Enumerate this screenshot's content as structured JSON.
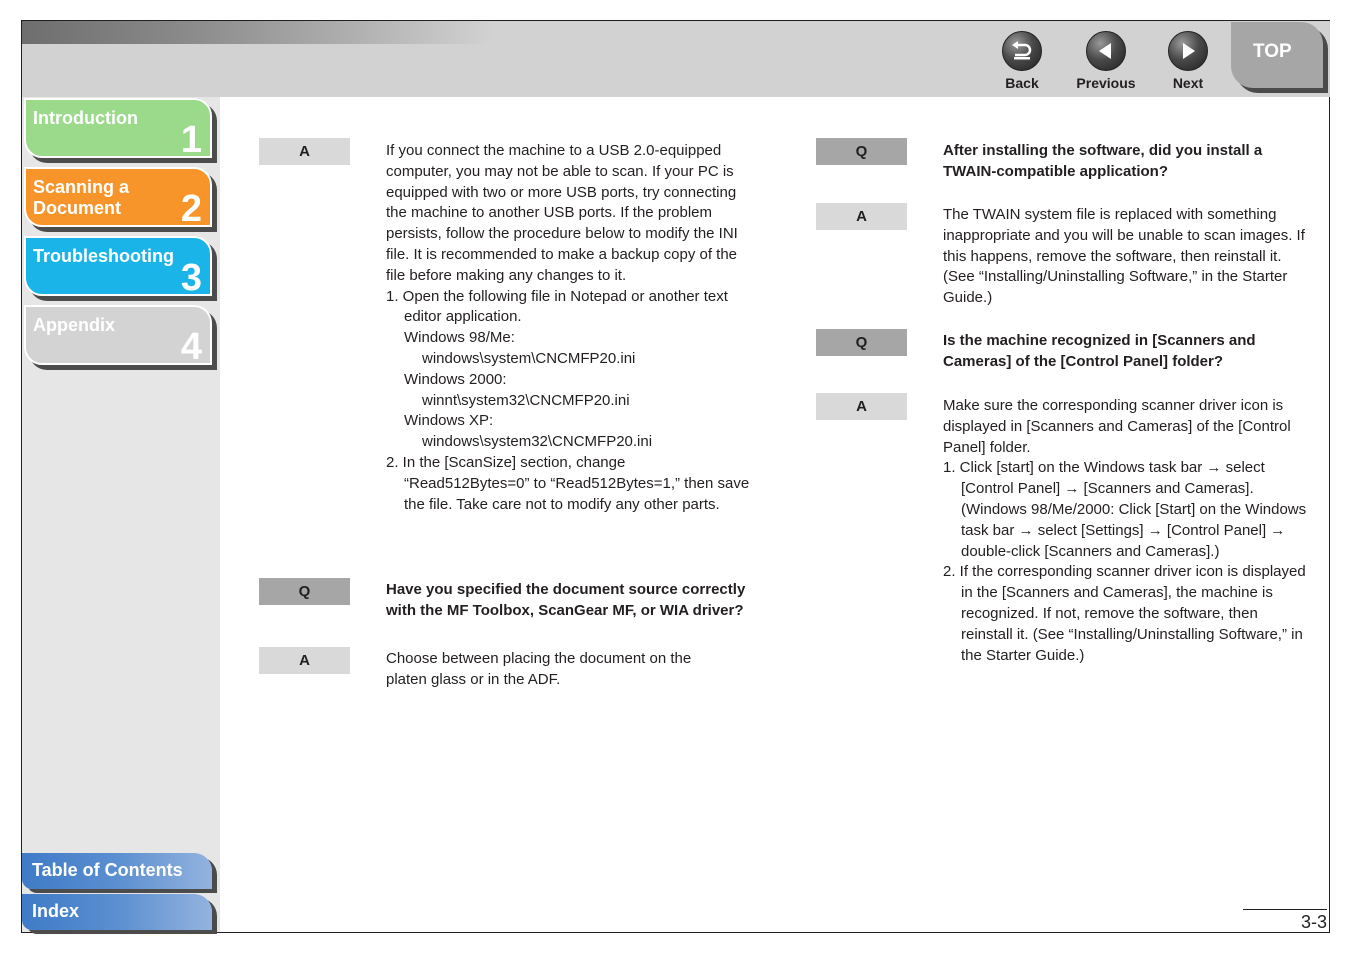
{
  "header": {
    "nav": [
      {
        "id": "back",
        "label": "Back",
        "icon": "back-arrow-icon"
      },
      {
        "id": "previous",
        "label": "Previous",
        "icon": "triangle-left-icon"
      },
      {
        "id": "next",
        "label": "Next",
        "icon": "triangle-right-icon"
      }
    ],
    "top_label": "TOP"
  },
  "sidebar": {
    "chapters": [
      {
        "label": "Introduction",
        "number": "1",
        "color": "#9bd98b"
      },
      {
        "label": "Scanning a Document",
        "number": "2",
        "color": "#f7942a"
      },
      {
        "label": "Troubleshooting",
        "number": "3",
        "color": "#1bb4e8"
      },
      {
        "label": "Appendix",
        "number": "4",
        "color": "#d3d3d3"
      }
    ],
    "bottom_links": [
      {
        "label": "Table of Contents"
      },
      {
        "label": "Index"
      }
    ]
  },
  "labels": {
    "q": "Q",
    "a": "A"
  },
  "left_column": {
    "a1": {
      "intro": "If you connect the machine to a USB 2.0-equipped computer, you may not be able to scan. If your PC is equipped with two or more USB ports, try connecting the machine to another USB ports. If the problem persists, follow the procedure below to modify the INI file. It is recommended to make a backup copy of the file before making any changes to it.",
      "step1": "1. Open the following file in Notepad or another text editor application.",
      "os": [
        {
          "name": "Windows 98/Me:",
          "path": "windows\\system\\CNCMFP20.ini"
        },
        {
          "name": "Windows 2000:",
          "path": "winnt\\system32\\CNCMFP20.ini"
        },
        {
          "name": "Windows XP:",
          "path": "windows\\system32\\CNCMFP20.ini"
        }
      ],
      "step2": "2. In the [ScanSize] section, change “Read512Bytes=0” to “Read512Bytes=1,” then save the file. Take care not to modify any other parts."
    },
    "q2": "Have you specified the document source correctly with the MF Toolbox, ScanGear MF, or WIA driver?",
    "a2": "Choose between placing the document on the platen glass or in the ADF."
  },
  "right_column": {
    "q1": "After installing the software, did you install a TWAIN-compatible application?",
    "a1": "The TWAIN system file is replaced with something inappropriate and you will be unable to scan images. If this happens, remove the software, then reinstall it. (See “Installing/Uninstalling Software,” in the Starter Guide.)",
    "q2": "Is the machine recognized in [Scanners and Cameras] of the [Control Panel] folder?",
    "a2": {
      "intro": "Make sure the corresponding scanner driver icon is displayed in [Scanners and Cameras] of the [Control Panel] folder.",
      "step1": "1. Click [start] on the Windows task bar → select [Control Panel] → [Scanners and Cameras]. (Windows 98/Me/2000: Click [Start] on the Windows task bar → select [Settings] → [Control Panel] → double-click [Scanners and Cameras].)",
      "step2": "2. If the corresponding scanner driver icon is displayed in the [Scanners and Cameras], the machine is recognized. If not, remove the software, then reinstall it. (See “Installing/Uninstalling Software,” in the Starter Guide.)"
    }
  },
  "footer": {
    "page_number": "3-3"
  }
}
